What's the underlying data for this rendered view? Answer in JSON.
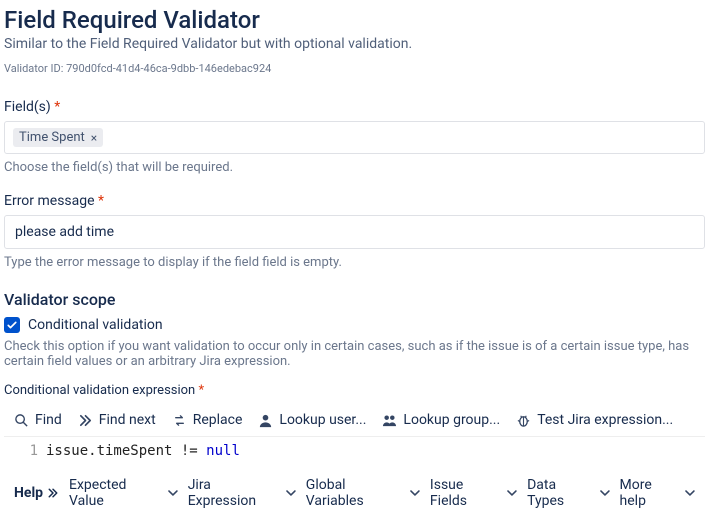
{
  "header": {
    "title": "Field Required Validator",
    "subtitle": "Similar to the Field Required Validator but with optional validation.",
    "validator_id_full": "Validator ID: 790d0fcd-41d4-46ca-9dbb-146edebac924"
  },
  "fields_section": {
    "label": "Field(s)",
    "required_mark": "*",
    "chips": [
      {
        "label": "Time Spent"
      }
    ],
    "help": "Choose the field(s) that will be required."
  },
  "error_section": {
    "label": "Error message",
    "required_mark": "*",
    "value": "please add time",
    "help": "Type the error message to display if the field field is empty."
  },
  "scope_section": {
    "heading": "Validator scope",
    "checkbox_label": "Conditional validation",
    "checked": true,
    "description": "Check this option if you want validation to occur only in certain cases, such as if the issue is of a certain issue type, has certain field values or an arbitrary Jira expression."
  },
  "expression_section": {
    "label": "Conditional validation expression",
    "required_mark": "*",
    "toolbar": {
      "find": "Find",
      "find_next": "Find next",
      "replace": "Replace",
      "lookup_user": "Lookup user...",
      "lookup_group": "Lookup group...",
      "test_expr": "Test Jira expression..."
    },
    "code": {
      "line_number": "1",
      "text_pre": "issue.timeSpent != ",
      "text_kw": "null"
    },
    "bottombar": {
      "help": "Help",
      "expected_value": "Expected Value",
      "jira_expression": "Jira Expression",
      "global_variables": "Global Variables",
      "issue_fields": "Issue Fields",
      "data_types": "Data Types",
      "more_help": "More help"
    }
  }
}
